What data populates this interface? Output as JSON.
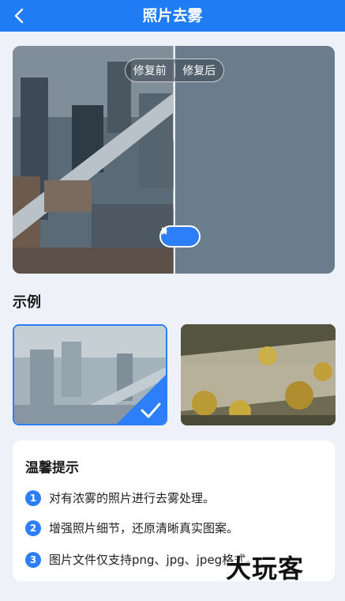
{
  "header": {
    "title": "照片去雾",
    "back_icon": "chevron-left-icon"
  },
  "compare": {
    "before_label": "修复前",
    "after_label": "修复后"
  },
  "examples": {
    "title": "示例",
    "selected_index": 0
  },
  "tips": {
    "title": "温馨提示",
    "items": [
      {
        "num": "1",
        "text": "对有浓雾的照片进行去雾处理。"
      },
      {
        "num": "2",
        "text": "增强照片细节，还原清晰真实图案。"
      },
      {
        "num": "3",
        "text": "图片文件仅支持png、jpg、jpeg格式。"
      }
    ]
  },
  "watermark": "大玩客",
  "colors": {
    "primary": "#1f7cf5",
    "accent": "#2d7ff9",
    "background": "#eef1f7"
  }
}
